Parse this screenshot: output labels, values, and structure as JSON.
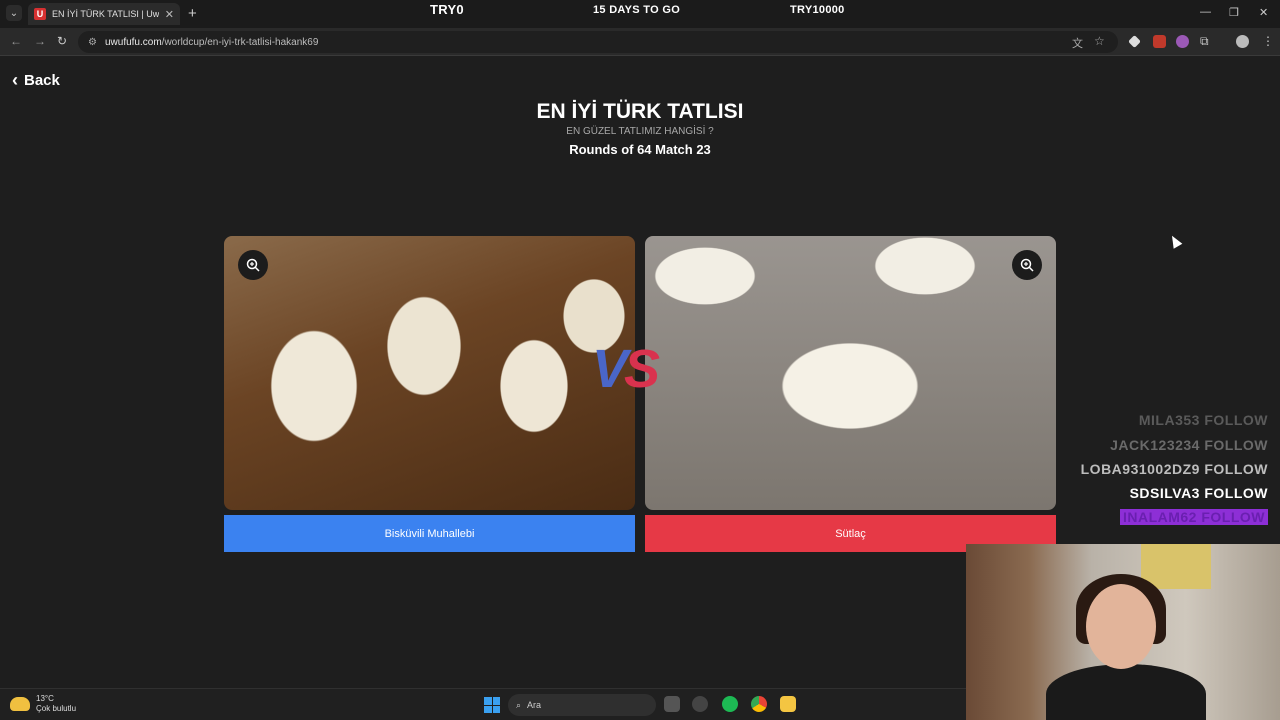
{
  "browser": {
    "tab_title": "EN İYİ TÜRK TATLISI | UwUFUFU",
    "tab_favicon_letter": "U",
    "new_tab_label": "+",
    "tab_close": "✕",
    "url_host": "uwufufu.com",
    "url_path": "/worldcup/en-iyi-trk-tatlisi-hakank69"
  },
  "stream_overlay": {
    "left": "TRY0",
    "center": "15 DAYS TO GO",
    "right": "TRY10000"
  },
  "page": {
    "back_label": "Back",
    "title": "EN İYİ TÜRK TATLISI",
    "subtitle": "EN GÜZEL TATLIMIZ HANGİSİ ?",
    "round": "Rounds of 64 Match 23",
    "vs_v": "V",
    "vs_s": "S",
    "left_choice": "Bisküvili Muhallebi",
    "right_choice": "Sütlaç"
  },
  "follows": [
    "MILA353  FOLLOW",
    "JACK123234  FOLLOW",
    "LOBA931002DZ9  FOLLOW",
    "SDSILVA3  FOLLOW",
    "INALAM62  FOLLOW"
  ],
  "taskbar": {
    "temperature": "13°C",
    "weather": "Çok bulutlu",
    "search_placeholder": "Ara"
  },
  "colors": {
    "left_button": "#3b82f0",
    "right_button": "#e63946",
    "follow_highlight": "#8d2fd6"
  }
}
